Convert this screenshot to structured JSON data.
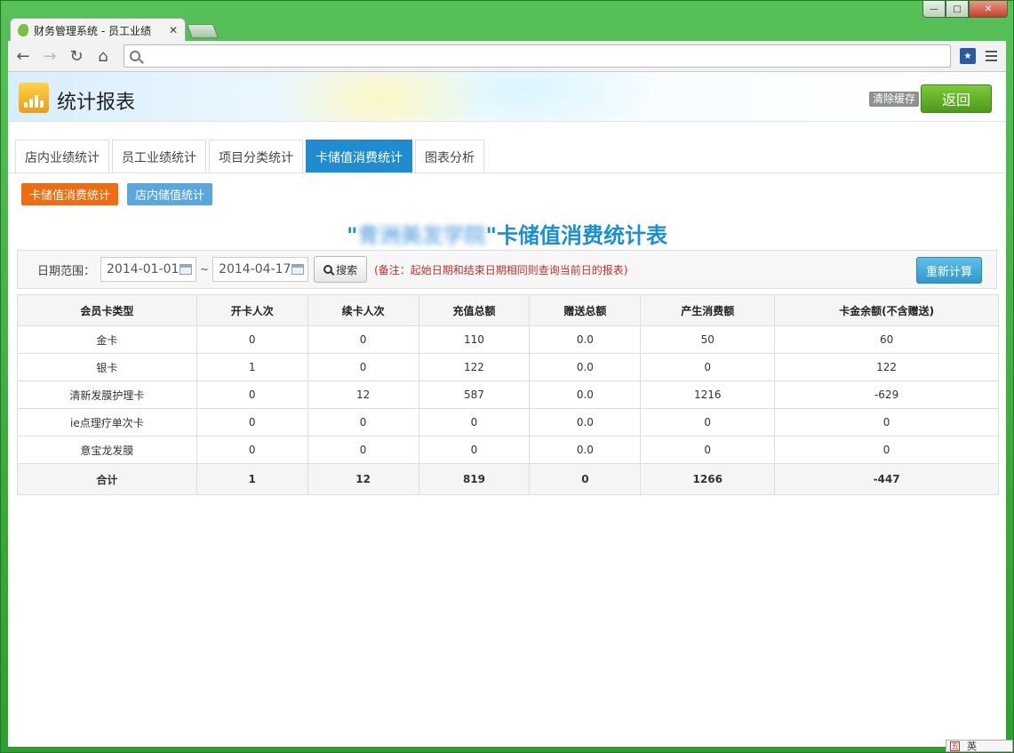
{
  "browser": {
    "tab_title": "财务管理系统 - 员工业绩",
    "close_glyph": "✕",
    "url": "",
    "win_min": "—",
    "win_max": "□",
    "win_close": "✕",
    "nav_back": "←",
    "nav_forward": "→",
    "nav_reload": "↻",
    "nav_home": "⌂",
    "bookmark_glyph": "★"
  },
  "header": {
    "title": "统计报表",
    "clear_cache": "清除缓存",
    "back": "返回"
  },
  "main_tabs": [
    {
      "label": "店内业绩统计"
    },
    {
      "label": "员工业绩统计"
    },
    {
      "label": "项目分类统计"
    },
    {
      "label": "卡储值消费统计"
    },
    {
      "label": "图表分析"
    }
  ],
  "sub_tabs": [
    {
      "label": "卡储值消费统计"
    },
    {
      "label": "店内储值统计"
    }
  ],
  "report": {
    "title_quote_open": "\"",
    "title_blurred": "青洲美发学院",
    "title_quote_close": "\"",
    "title_suffix": "卡储值消费统计表"
  },
  "filter": {
    "label": "日期范围：",
    "start_date": "2014-01-01",
    "separator": "~",
    "end_date": "2014-04-17",
    "search_label": "搜索",
    "note": "(备注：起始日期和结束日期相同则查询当前日的报表)",
    "recalc_label": "重新计算"
  },
  "table": {
    "headers": [
      "会员卡类型",
      "开卡人次",
      "续卡人次",
      "充值总额",
      "赠送总额",
      "产生消费额",
      "卡金余额(不含赠送)"
    ],
    "rows": [
      [
        "金卡",
        "0",
        "0",
        "110",
        "0.0",
        "50",
        "60"
      ],
      [
        "银卡",
        "1",
        "0",
        "122",
        "0.0",
        "0",
        "122"
      ],
      [
        "清新发膜护理卡",
        "0",
        "12",
        "587",
        "0.0",
        "1216",
        "-629"
      ],
      [
        "ie点理疗单次卡",
        "0",
        "0",
        "0",
        "0.0",
        "0",
        "0"
      ],
      [
        "意宝龙发膜",
        "0",
        "0",
        "0",
        "0.0",
        "0",
        "0"
      ]
    ],
    "total": [
      "合计",
      "1",
      "12",
      "819",
      "0",
      "1266",
      "-447"
    ]
  },
  "ime": {
    "logo": "五",
    "mode": "英"
  },
  "colors": {
    "active_tab": "#1f8bd0",
    "sub_tab_orange": "#ee6d11",
    "sub_tab_blue": "#5aa7df",
    "back_button": "#5aaa24",
    "report_title": "#1b8fd6",
    "note_red": "#c0302a"
  }
}
